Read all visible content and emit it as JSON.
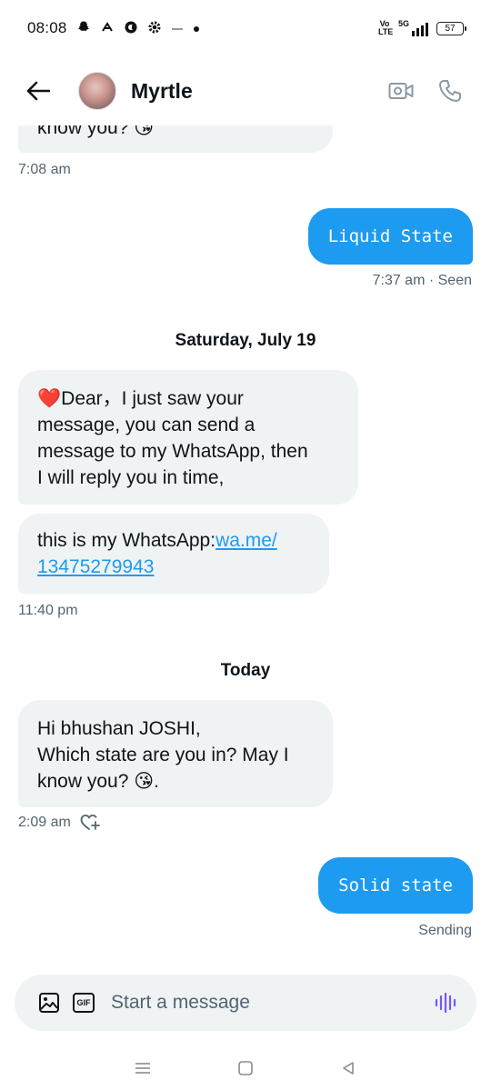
{
  "status_bar": {
    "time": "08:08",
    "network": "5G",
    "volte": "Vo LTE",
    "battery": "57"
  },
  "header": {
    "contact_name": "Myrtle"
  },
  "messages": {
    "m1_text": "know you? 😘",
    "m1_time": "7:08 am",
    "m2_text": "Liquid State",
    "m2_meta": "7:37 am · Seen",
    "date1": "Saturday, July 19",
    "m3_text_line1": "❤️Dear，I just saw your",
    "m3_text_line2": "message, you can send a",
    "m3_text_line3": "message to my WhatsApp, then",
    "m3_text_line4": "I will reply you in time,",
    "m4_prefix": "this is my WhatsApp:",
    "m4_link_line1": "wa.me/",
    "m4_link_line2": "13475279943",
    "m4_time": "11:40 pm",
    "date2": "Today",
    "m5_line1": "Hi bhushan JOSHI,",
    "m5_line2": "Which state are you in? May I",
    "m5_line3": "know you? 😘.",
    "m5_time": "2:09 am",
    "m6_text": "Solid state",
    "m6_meta": "Sending"
  },
  "composer": {
    "placeholder": "Start a message",
    "gif_label": "GIF"
  },
  "icons": {
    "back": "arrow-left-icon",
    "video": "video-call-icon",
    "call": "phone-icon",
    "image": "image-icon",
    "gif": "gif-icon",
    "voice": "voice-waveform-icon",
    "react": "add-reaction-icon"
  },
  "colors": {
    "accent": "#1d9bf0",
    "bubble_in": "#eff3f4",
    "voice_icon": "#7856ff"
  }
}
